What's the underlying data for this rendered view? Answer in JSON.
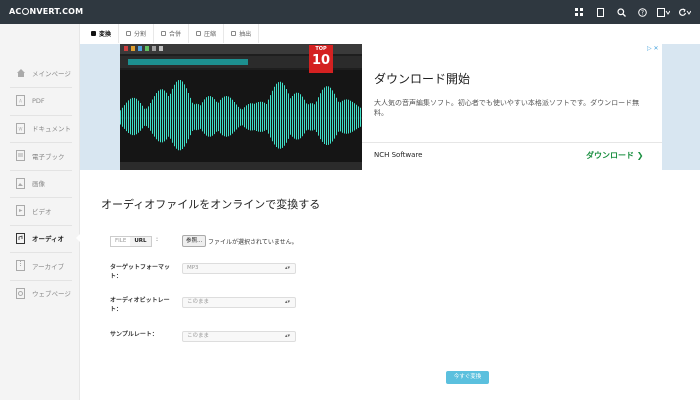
{
  "header": {
    "logo_prefix": "AC",
    "logo_suffix": "NVERT.COM",
    "icons": [
      "grid-icon",
      "bookmark-icon",
      "search-icon",
      "help-icon",
      "language-icon",
      "refresh-icon"
    ]
  },
  "sidebar": {
    "items": [
      {
        "label": "メインページ",
        "icon": "home-icon"
      },
      {
        "label": "PDF",
        "icon": "pdf-icon"
      },
      {
        "label": "ドキュメント",
        "icon": "document-icon"
      },
      {
        "label": "電子ブック",
        "icon": "ebook-icon"
      },
      {
        "label": "画像",
        "icon": "image-icon"
      },
      {
        "label": "ビデオ",
        "icon": "video-icon"
      },
      {
        "label": "オーディオ",
        "icon": "audio-icon",
        "active": true
      },
      {
        "label": "アーカイブ",
        "icon": "archive-icon"
      },
      {
        "label": "ウェブページ",
        "icon": "webpage-icon"
      }
    ]
  },
  "tabs": [
    {
      "label": "変換",
      "active": true
    },
    {
      "label": "分割"
    },
    {
      "label": "合併"
    },
    {
      "label": "圧縮"
    },
    {
      "label": "抽出"
    }
  ],
  "ad": {
    "badge_top": "TOP",
    "badge_number": "10",
    "title": "ダウンロード開始",
    "description": "大人気の音声編集ソフト。初心者でも使いやすい本格派ソフトです。ダウンロード無料。",
    "advertiser": "NCH Software",
    "cta": "ダウンロード",
    "choices_label": "▷ ✕"
  },
  "main": {
    "title": "オーディオファイルをオンラインで変換する",
    "source_toggle": {
      "file": "FILE",
      "url": "URL",
      "colon": ":"
    },
    "browse_button": "参照...",
    "no_file_text": "ファイルが選択されていません。",
    "fields": [
      {
        "label": "ターゲットフォーマット：",
        "value": "MP3"
      },
      {
        "label": "オーディオビットレート：",
        "value": "このまま"
      },
      {
        "label": "サンプルレート：",
        "value": "このまま"
      }
    ],
    "convert_button": "今すぐ変換"
  },
  "colors": {
    "topbar": "#2f3840",
    "accent": "#5bc0de",
    "ad_green": "#1a8f40",
    "badge_red": "#d42121"
  }
}
